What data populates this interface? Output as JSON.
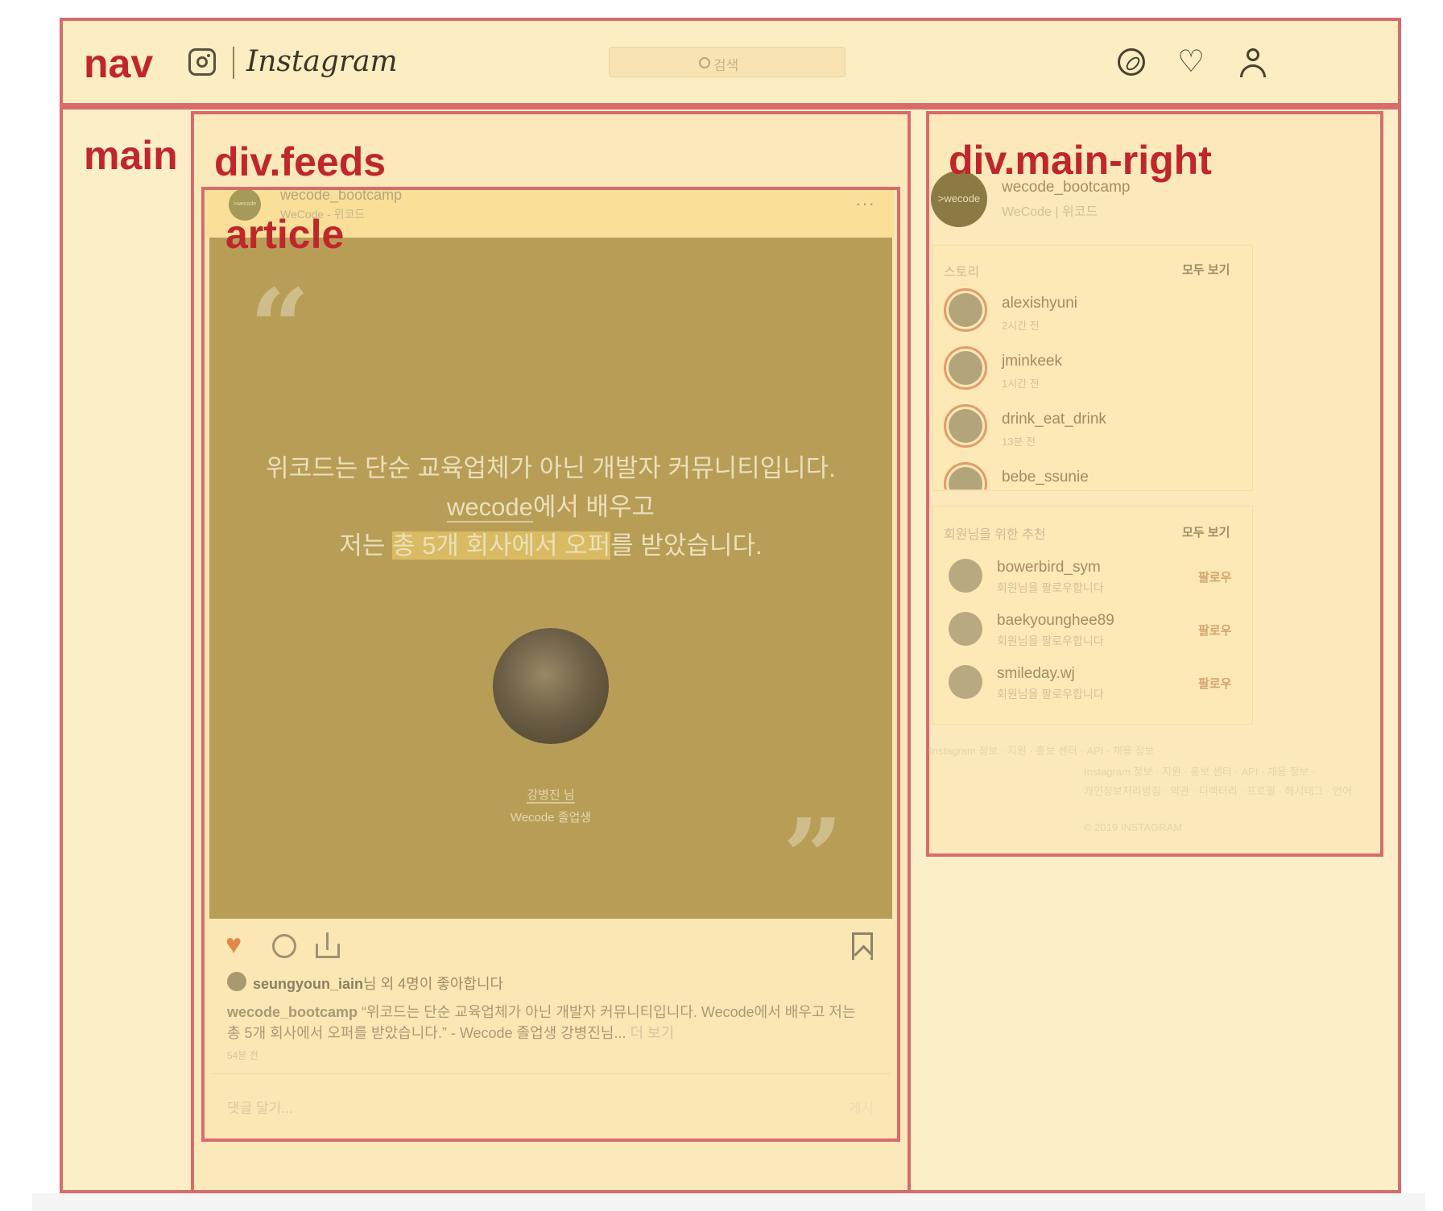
{
  "annotations": {
    "nav": "nav",
    "main": "main",
    "feeds": "div.feeds",
    "article": "article",
    "main_right": "div.main-right"
  },
  "nav": {
    "wordmark": "Instagram",
    "search_placeholder": "검색",
    "icons": [
      "camera-icon",
      "compass-icon",
      "heart-icon",
      "user-icon"
    ]
  },
  "article": {
    "avatar_text": ">wecode",
    "username": "wecode_bootcamp",
    "location": "WeCode - 위코드",
    "menu": "···",
    "media": {
      "open_quote": "“",
      "close_quote": "”",
      "line1": "위코드는 단순 교육업체가 아닌 개발자 커뮤니티입니다.",
      "line2_highlight": "wecode",
      "line2_rest": "에서 배우고",
      "line3_pre": "저는 ",
      "line3_highlight": "총 5개 회사에서 오퍼",
      "line3_post": "를 받았습니다.",
      "person_name": "강병진 님",
      "person_title": "Wecode 졸업생"
    },
    "likes_user": "seungyoun_iain",
    "likes_rest": "님 외 4명이 좋아합니다",
    "caption_user": "wecode_bootcamp",
    "caption_text": " “위코드는 단순 교육업체가 아닌 개발자 커뮤니티입니다. Wecode에서 배우고 저는 총 5개 회사에서 오퍼를 받았습니다.” - Wecode 졸업생 강병진님...",
    "caption_more": " 더 보기",
    "time": "54분 전",
    "comment_placeholder": "댓글 달기...",
    "comment_post": "게시"
  },
  "right": {
    "avatar_text": ">wecode",
    "username": "wecode_bootcamp",
    "subtitle": "WeCode | 위코드",
    "stories": {
      "title": "스토리",
      "see_all": "모두 보기",
      "items": [
        {
          "name": "alexishyuni",
          "time": "2시간 전"
        },
        {
          "name": "jminkeek",
          "time": "1시간 전"
        },
        {
          "name": "drink_eat_drink",
          "time": "13분 전"
        },
        {
          "name": "bebe_ssunie",
          "time": ""
        }
      ]
    },
    "recommend": {
      "title": "회원님을 위한 추천",
      "see_all": "모두 보기",
      "items": [
        {
          "name": "bowerbird_sym",
          "sub": "회원님을 팔로우합니다",
          "action": "팔로우"
        },
        {
          "name": "baekyounghee89",
          "sub": "회원님을 팔로우합니다",
          "action": "팔로우"
        },
        {
          "name": "smileday.wj",
          "sub": "회원님을 팔로우합니다",
          "action": "팔로우"
        }
      ]
    },
    "footer_line0": "Instagram 정보 · 지원 · 홍보 센터 · API · 채용 정보 ·",
    "footer_line1": "Instagram 정보 · 지원 · 홍보 센터 · API · 채용 정보 ·",
    "footer_line2": "개인정보처리방침 · 약관 · 디렉터리 · 프로필 · 해시태그 · 언어",
    "copyright": "© 2019 INSTAGRAM"
  }
}
